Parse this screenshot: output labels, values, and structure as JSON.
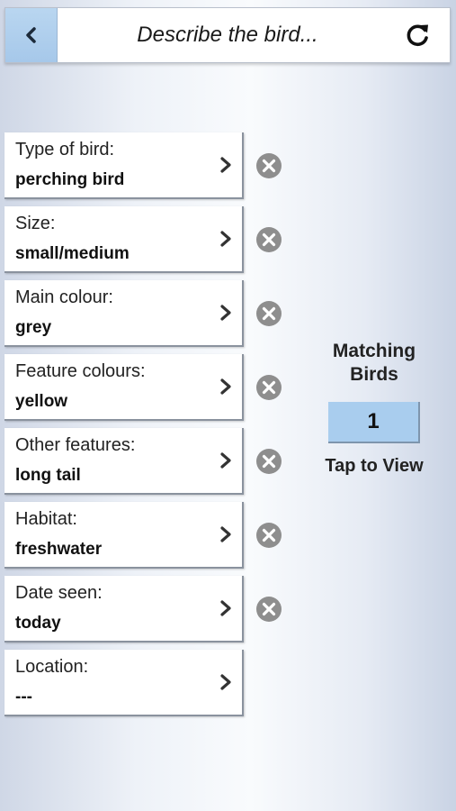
{
  "header": {
    "title": "Describe the bird...",
    "back_icon": "chevron-left-icon",
    "refresh_icon": "refresh-icon"
  },
  "fields": [
    {
      "label": "Type of bird:",
      "value": "perching bird",
      "clearable": true
    },
    {
      "label": "Size:",
      "value": "small/medium",
      "clearable": true
    },
    {
      "label": "Main colour:",
      "value": "grey",
      "clearable": true
    },
    {
      "label": "Feature colours:",
      "value": "yellow",
      "clearable": true
    },
    {
      "label": "Other features:",
      "value": "long tail",
      "clearable": true
    },
    {
      "label": "Habitat:",
      "value": "freshwater",
      "clearable": true
    },
    {
      "label": "Date seen:",
      "value": "today",
      "clearable": true
    },
    {
      "label": "Location:",
      "value": "---",
      "clearable": false
    }
  ],
  "matching": {
    "title_line1": "Matching",
    "title_line2": "Birds",
    "count": "1",
    "action": "Tap to View"
  },
  "colors": {
    "accent_blue": "#a9cdee",
    "clear_icon_grey": "#8e8e8e"
  }
}
